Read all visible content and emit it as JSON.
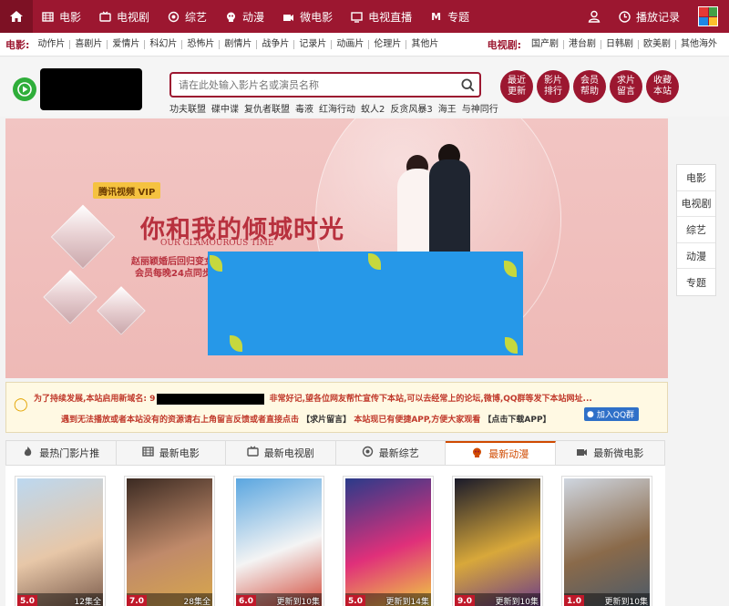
{
  "nav": {
    "items": [
      {
        "label": "电影",
        "icon": "film-icon"
      },
      {
        "label": "电视剧",
        "icon": "tv-icon"
      },
      {
        "label": "综艺",
        "icon": "variety-icon"
      },
      {
        "label": "动漫",
        "icon": "anime-icon"
      },
      {
        "label": "微电影",
        "icon": "micro-film-icon"
      },
      {
        "label": "电视直播",
        "icon": "live-tv-icon"
      },
      {
        "label": "专题",
        "icon": "topic-icon",
        "glyph": "M"
      }
    ],
    "history_label": "播放记录",
    "brand_colors": [
      "#e53935",
      "#43a047",
      "#1e88e5",
      "#fbc02d"
    ]
  },
  "subnav": {
    "movie_title": "电影:",
    "movie_links": [
      "动作片",
      "喜剧片",
      "爱情片",
      "科幻片",
      "恐怖片",
      "剧情片",
      "战争片",
      "记录片",
      "动画片",
      "伦理片",
      "其他片"
    ],
    "tv_title": "电视剧:",
    "tv_links": [
      "国产剧",
      "港台剧",
      "日韩剧",
      "欧美剧",
      "其他海外"
    ]
  },
  "search": {
    "placeholder": "请在此处输入影片名或演员名称",
    "hotwords": [
      "功夫联盟",
      "碟中谍",
      "复仇者联盟",
      "毒液",
      "红海行动",
      "蚁人2",
      "反贪风暴3",
      "海王",
      "与神同行"
    ]
  },
  "quick": [
    "最近更新",
    "影片排行",
    "会员帮助",
    "求片留言",
    "收藏本站"
  ],
  "banner": {
    "vip_badge": "腾讯视频 VIP",
    "tagline": "你和我的倾城时光",
    "tagline_sub": "OUR GLAMOUROUS TIME",
    "line1": "赵丽颖婚后回归变女霸",
    "line2": "会员每晚24点同步更新"
  },
  "side_menu": [
    "电影",
    "电视剧",
    "综艺",
    "动漫",
    "专题"
  ],
  "notice": {
    "line1_a": "为了持续发展,本站启用新域名:",
    "line1_b": "9",
    "line1_c": "非常好记,望各位网友帮忙宣传下本站,可以去经常上的论坛,微博,QQ群等发下本站网址...",
    "line2_a": "遇到无法播放或者本站没有的资源请右上角留言反馈或者直接点击",
    "line2_link": "【求片留言】",
    "line2_b": "本站现已有便捷APP,方便大家观看",
    "line2_dl": "【点击下载APP】",
    "qq_label": "加入QQ群"
  },
  "tabs": [
    {
      "label": "最热门影片推",
      "icon": "fire-icon",
      "active": false
    },
    {
      "label": "最新电影",
      "icon": "film-icon",
      "active": false
    },
    {
      "label": "最新电视剧",
      "icon": "tv-icon",
      "active": false
    },
    {
      "label": "最新综艺",
      "icon": "variety-icon",
      "active": false
    },
    {
      "label": "最新动漫",
      "icon": "anime-icon",
      "active": true
    },
    {
      "label": "最新微电影",
      "icon": "micro-film-icon",
      "active": false
    }
  ],
  "posters": [
    {
      "score": "5.0",
      "ep": "12集全",
      "colors": [
        "#bcd8f0",
        "#e7c7a8",
        "#7a5a4a"
      ]
    },
    {
      "score": "7.0",
      "ep": "28集全",
      "colors": [
        "#3b2a22",
        "#c08a6a",
        "#d9a84a"
      ]
    },
    {
      "score": "6.0",
      "ep": "更新到10集",
      "colors": [
        "#5aa6e0",
        "#f4f4f4",
        "#d24a3a"
      ]
    },
    {
      "score": "5.0",
      "ep": "更新到14集",
      "colors": [
        "#2a3b8a",
        "#e0307a",
        "#f0d040"
      ]
    },
    {
      "score": "9.0",
      "ep": "更新到10集",
      "colors": [
        "#1a1a2a",
        "#d8a83a",
        "#6a3a8a"
      ]
    },
    {
      "score": "1.0",
      "ep": "更新到10集",
      "colors": [
        "#cfd6e0",
        "#8a6a4a",
        "#4a5a6a"
      ]
    }
  ]
}
